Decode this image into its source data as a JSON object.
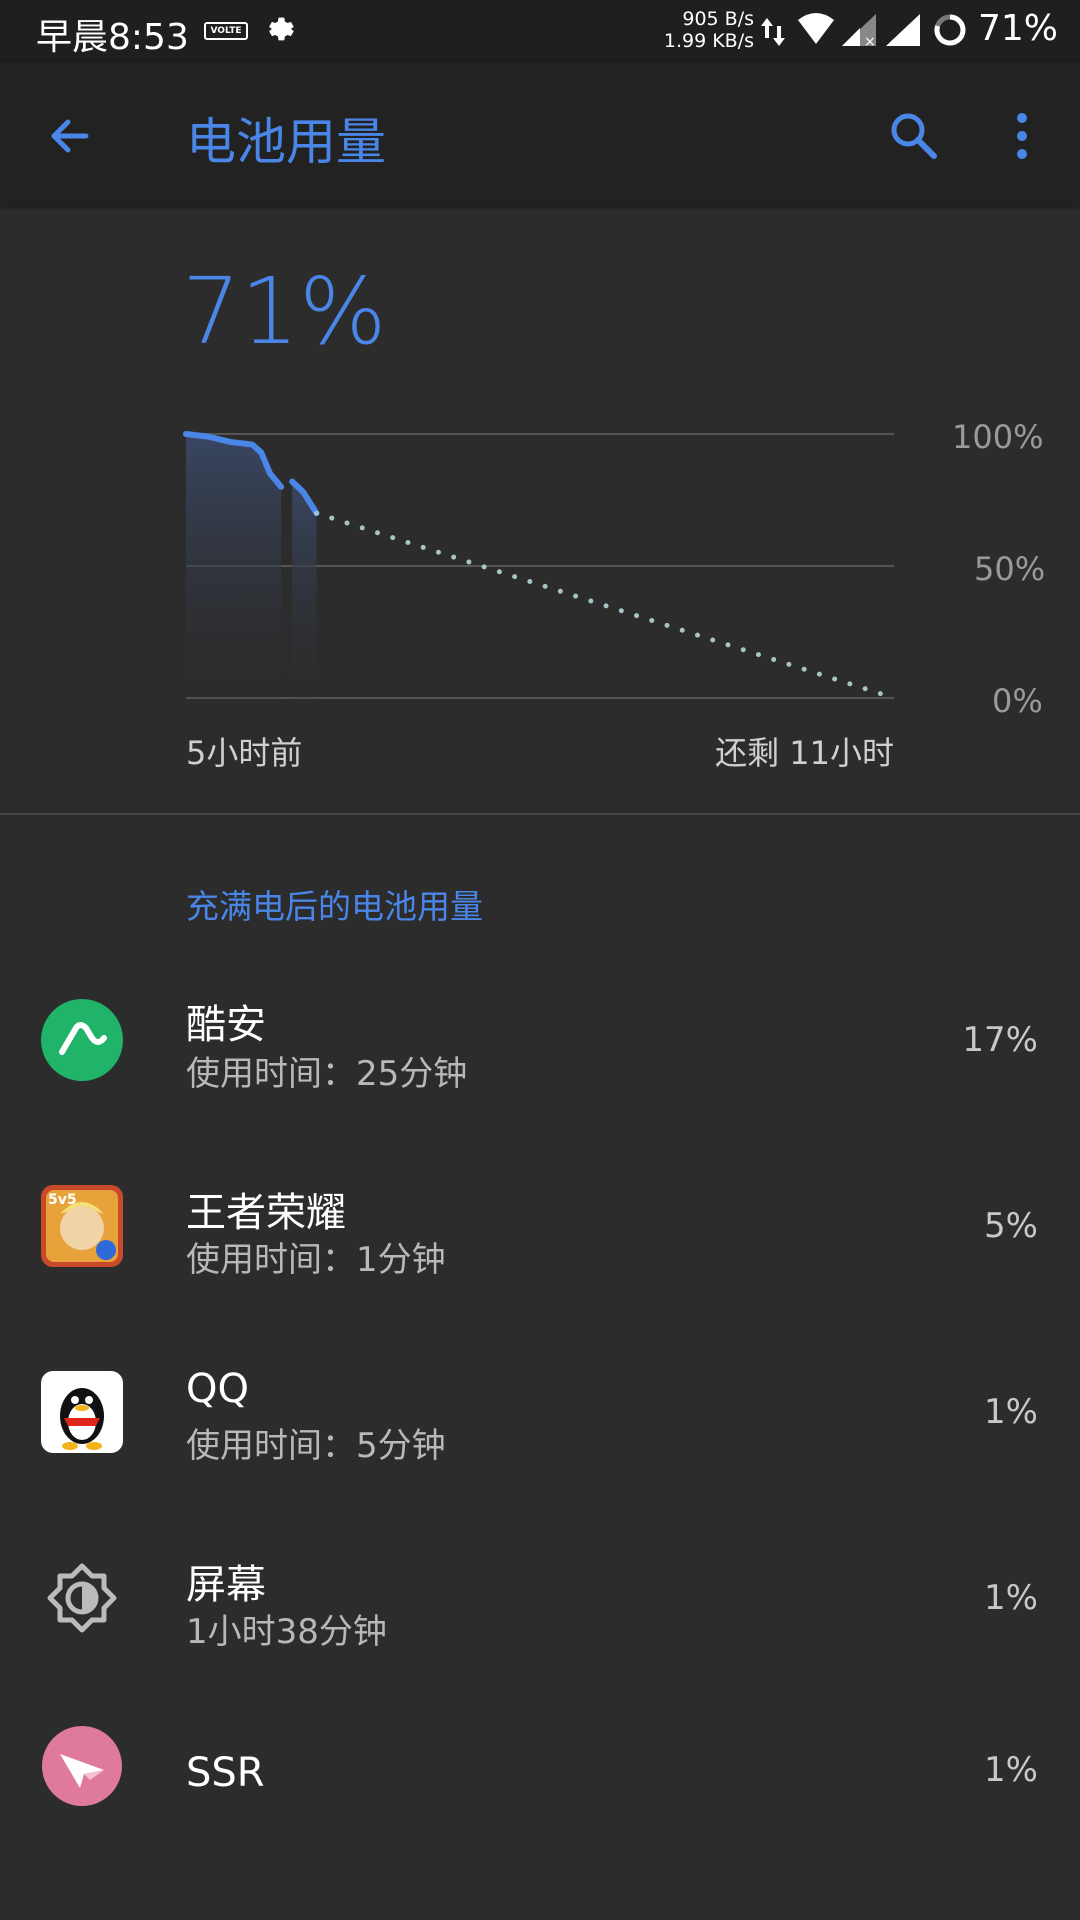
{
  "status_bar": {
    "time": "早晨8:53",
    "volte": "VOLTE",
    "net_up": "905 B/s",
    "net_down": "1.99 KB/s",
    "battery": "71%"
  },
  "app_bar": {
    "title": "电池用量"
  },
  "battery": {
    "percent": "71%"
  },
  "chart_data": {
    "type": "line",
    "y_ticks": [
      "100%",
      "50%",
      "0%"
    ],
    "x_start_label": "5小时前",
    "x_end_label": "还剩 11小时",
    "ylim": [
      0,
      100
    ],
    "xlim": [
      -5,
      11
    ],
    "series": [
      {
        "style": "solid",
        "x": [
          -5,
          -4.5,
          -4,
          -3.5,
          -3.3,
          -3.1,
          -2.85
        ],
        "y": [
          100,
          99,
          97,
          96,
          93,
          85,
          80
        ]
      },
      {
        "style": "solid",
        "x": [
          -2.6,
          -2.35,
          -2.05
        ],
        "y": [
          82,
          78,
          70
        ]
      },
      {
        "style": "dotted",
        "x": [
          -2.05,
          11
        ],
        "y": [
          70,
          0
        ]
      }
    ],
    "gaps": [
      [
        -2.85,
        -2.6
      ]
    ],
    "colors": {
      "line": "#4a86e8",
      "projection": "#a9c4c8",
      "grid": "#555555"
    }
  },
  "section": {
    "title": "充满电后的电池用量"
  },
  "usage_items": [
    {
      "name": "酷安",
      "sub": "使用时间：25分钟",
      "percent": "17%",
      "icon": "coolapk-icon",
      "color": "#1fb467"
    },
    {
      "name": "王者荣耀",
      "sub": "使用时间：1分钟",
      "percent": "5%",
      "icon": "honor-of-kings-icon",
      "color": "#c94a2a"
    },
    {
      "name": "QQ",
      "sub": "使用时间：5分钟",
      "percent": "1%",
      "icon": "qq-penguin-icon",
      "color": "#ffffff"
    },
    {
      "name": "屏幕",
      "sub": "1小时38分钟",
      "percent": "1%",
      "icon": "brightness-icon",
      "color": "#bbbbbb"
    },
    {
      "name": "SSR",
      "sub": "",
      "percent": "1%",
      "icon": "paper-plane-icon",
      "color": "#e07a9a"
    }
  ]
}
